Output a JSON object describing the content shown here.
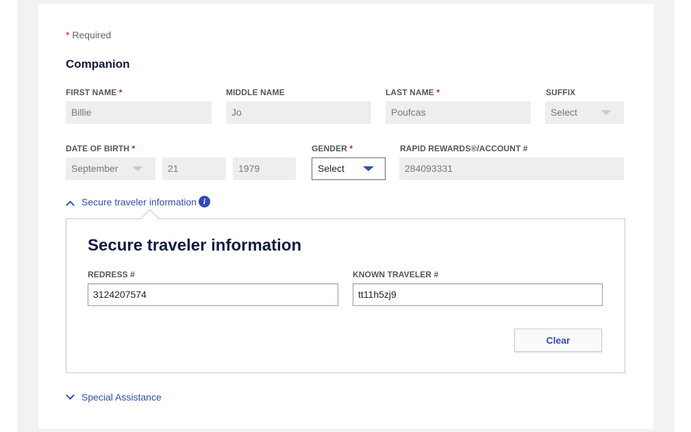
{
  "form": {
    "required_star": "*",
    "required_label": "Required",
    "section_title": "Companion"
  },
  "fields": {
    "first_name": {
      "label": "FIRST NAME",
      "required": "*",
      "value": "Billie"
    },
    "middle_name": {
      "label": "MIDDLE NAME",
      "value": "Jo"
    },
    "last_name": {
      "label": "LAST NAME",
      "required": "*",
      "value": "Poufcas"
    },
    "suffix": {
      "label": "SUFFIX",
      "value": "Select"
    },
    "date_of_birth": {
      "label": "DATE OF BIRTH",
      "required": "*",
      "month": "September",
      "day": "21",
      "year": "1979"
    },
    "gender": {
      "label": "GENDER",
      "required": "*",
      "value": "Select"
    },
    "rapid_rewards": {
      "label": "RAPID REWARDS®/ACCOUNT #",
      "value": "284093331"
    }
  },
  "secure_toggle": {
    "label": "Secure traveler information",
    "info_icon": "i"
  },
  "secure_panel": {
    "title": "Secure traveler information",
    "redress": {
      "label": "REDRESS #",
      "value": "3124207574"
    },
    "known_traveler": {
      "label": "KNOWN TRAVELER #",
      "value": "tt11h5zj9"
    },
    "clear_label": "Clear"
  },
  "special_assistance": {
    "label": "Special Assistance"
  },
  "colors": {
    "accent": "#304cb2",
    "required": "#c8102e",
    "heading": "#111b40",
    "field_bg": "#eeeeee"
  }
}
